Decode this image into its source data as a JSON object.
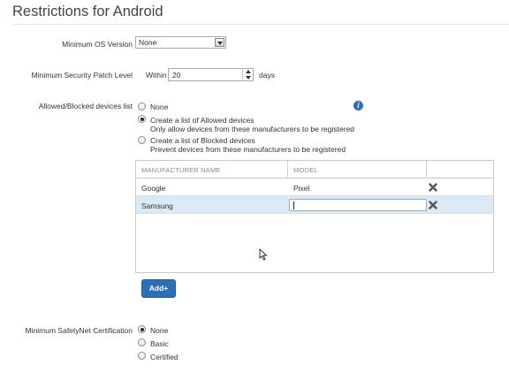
{
  "page": {
    "title": "Restrictions for Android"
  },
  "min_os": {
    "label": "Minimum OS Version",
    "value": "None"
  },
  "patch": {
    "label": "Minimum Security Patch Level",
    "prefix": "Within",
    "value": "20",
    "suffix": "days"
  },
  "devices_list": {
    "label": "Allowed/Blocked devices list",
    "options": [
      {
        "label": "None",
        "sub": "",
        "selected": false
      },
      {
        "label": "Create a list of Allowed devices",
        "sub": "Only allow devices from these manufacturers to be registered",
        "selected": true
      },
      {
        "label": "Create a list of Blocked devices",
        "sub": "Prevent devices from these manufacturers to be registered",
        "selected": false
      }
    ],
    "info_icon": "info-icon"
  },
  "table": {
    "headers": [
      "MANUFACTURER NAME",
      "MODEL"
    ],
    "rows": [
      {
        "manufacturer": "Google",
        "model": "Pixel",
        "selected": false
      },
      {
        "manufacturer": "Samsung",
        "model": "",
        "selected": true
      }
    ],
    "delete_icon": "delete-icon"
  },
  "add_button": {
    "label": "Add+"
  },
  "safetynet": {
    "label": "Minimum SafetyNet Certification",
    "options": [
      {
        "label": "None",
        "selected": true
      },
      {
        "label": "Basic",
        "selected": false
      },
      {
        "label": "Certified",
        "selected": false
      }
    ]
  },
  "colors": {
    "accent": "#2d6fb6",
    "row_highlight": "#dbeaf7",
    "delete": "#555555"
  }
}
